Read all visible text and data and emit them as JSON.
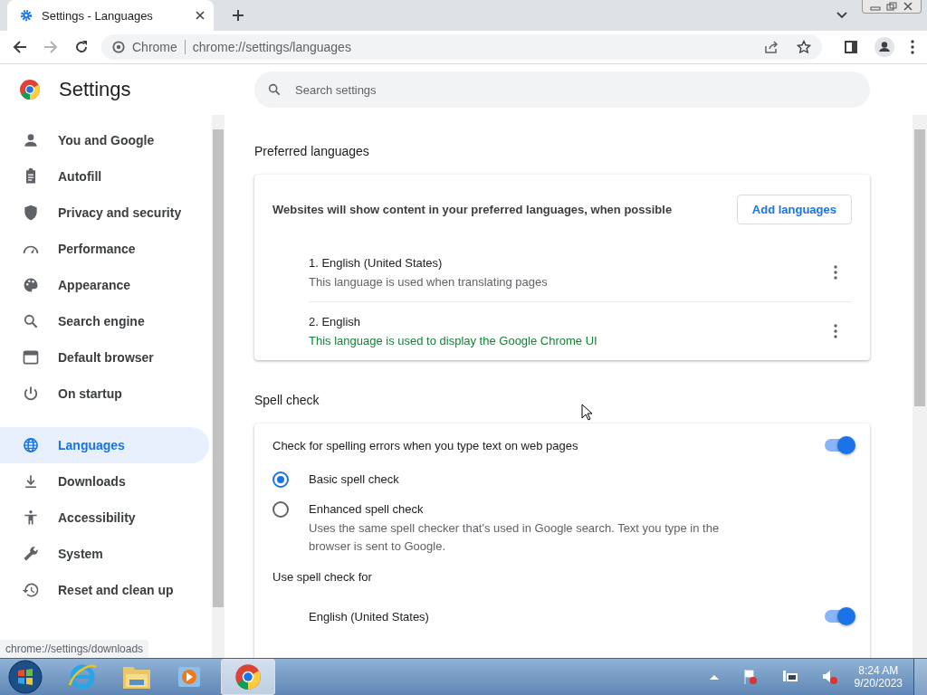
{
  "browser": {
    "tab": {
      "title": "Settings - Languages"
    },
    "address": {
      "site": "Chrome",
      "url": "chrome://settings/languages"
    }
  },
  "settings": {
    "title": "Settings",
    "search": {
      "placeholder": "Search settings"
    },
    "sidebar": [
      {
        "label": "You and Google",
        "selected": false
      },
      {
        "label": "Autofill",
        "selected": false
      },
      {
        "label": "Privacy and security",
        "selected": false
      },
      {
        "label": "Performance",
        "selected": false
      },
      {
        "label": "Appearance",
        "selected": false
      },
      {
        "label": "Search engine",
        "selected": false
      },
      {
        "label": "Default browser",
        "selected": false
      },
      {
        "label": "On startup",
        "selected": false
      },
      {
        "label": "Languages",
        "selected": true
      },
      {
        "label": "Downloads",
        "selected": false
      },
      {
        "label": "Accessibility",
        "selected": false
      },
      {
        "label": "System",
        "selected": false
      },
      {
        "label": "Reset and clean up",
        "selected": false
      }
    ],
    "preferred": {
      "heading": "Preferred languages",
      "description": "Websites will show content in your preferred languages, when possible",
      "button": "Add languages",
      "languages": [
        {
          "name": "1. English (United States)",
          "note": "This language is used when translating pages",
          "ui_language": false
        },
        {
          "name": "2. English",
          "note": "This language is used to display the Google Chrome UI",
          "ui_language": true
        }
      ]
    },
    "spell": {
      "heading": "Spell check",
      "rows": [
        {
          "kind": "toggle",
          "label": "Check for spelling errors when you type text on web pages",
          "on": true
        },
        {
          "kind": "radio",
          "label": "Basic spell check",
          "selected": true
        },
        {
          "kind": "radio",
          "label": "Enhanced spell check",
          "selected": false,
          "description": "Uses the same spell checker that's used in Google search. Text you type in the browser is sent to Google."
        },
        {
          "kind": "heading",
          "label": "Use spell check for"
        },
        {
          "kind": "language_toggle",
          "label": "English (United States)",
          "on": true
        }
      ]
    }
  },
  "status_bubble": "chrome://settings/downloads",
  "taskbar": {
    "time": "8:24 AM",
    "date": "9/20/2023"
  }
}
